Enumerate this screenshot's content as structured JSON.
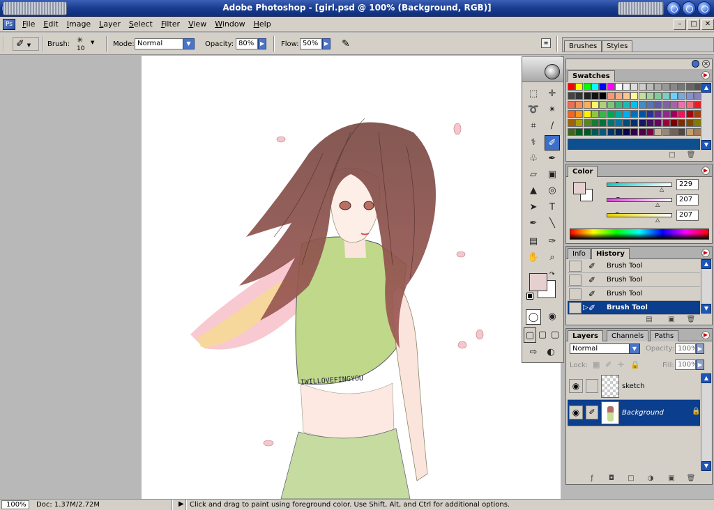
{
  "app": {
    "title": "Adobe Photoshop - [girl.psd @ 100% (Background, RGB)]"
  },
  "menubar": {
    "items": [
      "File",
      "Edit",
      "Image",
      "Layer",
      "Select",
      "Filter",
      "View",
      "Window",
      "Help"
    ],
    "doc_controls": [
      "–",
      "□",
      "✕"
    ]
  },
  "options": {
    "brush_label": "Brush:",
    "brush_size": "10",
    "mode_label": "Mode:",
    "mode_value": "Normal",
    "opacity_label": "Opacity:",
    "opacity_value": "80%",
    "flow_label": "Flow:",
    "flow_value": "50%"
  },
  "palette_well": {
    "tabs": [
      "Brushes",
      "Styles"
    ]
  },
  "swatches": {
    "tab": "Swatches",
    "rows": [
      [
        "#ff0000",
        "#ffff00",
        "#00ff00",
        "#00ffff",
        "#0000ff",
        "#ff00ff",
        "#ffffff",
        "#eeeeee",
        "#dddddd",
        "#cccccc",
        "#bbbbbb",
        "#aaaaaa",
        "#999999",
        "#888888",
        "#777777",
        "#666666",
        "#555555"
      ],
      [
        "#444444",
        "#333333",
        "#222222",
        "#111111",
        "#000000",
        "#f7977a",
        "#f9ad81",
        "#fdc68a",
        "#fff79a",
        "#c4df9b",
        "#a3d39c",
        "#82ca9d",
        "#7bcdc8",
        "#6ecff6",
        "#7ea7d8",
        "#8493ca",
        "#8882be"
      ],
      [
        "#f26c4f",
        "#f68e55",
        "#fbaf5c",
        "#fff467",
        "#acd372",
        "#7cc576",
        "#3bb878",
        "#1abbb4",
        "#00bff3",
        "#438ccb",
        "#5574b9",
        "#605ca8",
        "#855fa8",
        "#a763a8",
        "#f06ea9",
        "#f26d7d",
        "#ed1c24"
      ],
      [
        "#f26522",
        "#f7941d",
        "#fff200",
        "#8dc73f",
        "#39b54a",
        "#00a651",
        "#00a99d",
        "#00aeef",
        "#0072bc",
        "#0054a6",
        "#2e3192",
        "#662d91",
        "#92278f",
        "#9e005d",
        "#ed145b",
        "#9e0b0f",
        "#a0410d"
      ],
      [
        "#a36209",
        "#aba000",
        "#598527",
        "#1a7b30",
        "#007236",
        "#00746b",
        "#0076a3",
        "#004b80",
        "#003471",
        "#1b1464",
        "#440e62",
        "#630460",
        "#9e0039",
        "#790000",
        "#7b2e00",
        "#7d4900",
        "#827b00"
      ],
      [
        "#406618",
        "#005e20",
        "#005826",
        "#005952",
        "#005b7f",
        "#003663",
        "#002157",
        "#0d004c",
        "#32004b",
        "#4b0049",
        "#7b0046",
        "#c7b299",
        "#998675",
        "#736357",
        "#534741",
        "#c69c6d",
        "#a67c52"
      ]
    ],
    "footer_bar": "#0d4f8f"
  },
  "color": {
    "tab": "Color",
    "r_label": "R",
    "g_label": "G",
    "b_label": "B",
    "r": "229",
    "g": "207",
    "b": "207",
    "foreground": "#e5cfcf",
    "background": "#ffffff"
  },
  "history": {
    "tabs": [
      "Info",
      "History"
    ],
    "items": [
      "Brush Tool",
      "Brush Tool",
      "Brush Tool",
      "Brush Tool"
    ]
  },
  "layers": {
    "tabs": [
      "Layers",
      "Channels",
      "Paths"
    ],
    "blend_mode": "Normal",
    "opacity_label": "Opacity:",
    "opacity_value": "100%",
    "lock_label": "Lock:",
    "fill_label": "Fill:",
    "fill_value": "100%",
    "items": [
      {
        "name": "sketch"
      },
      {
        "name": "Background"
      }
    ]
  },
  "status": {
    "zoom": "100%",
    "doc": "Doc: 1.37M/2.72M",
    "hint": "Click and drag to paint using foreground color.  Use Shift, Alt, and Ctrl for additional options."
  },
  "tools": {
    "selected": "brush-tool"
  }
}
